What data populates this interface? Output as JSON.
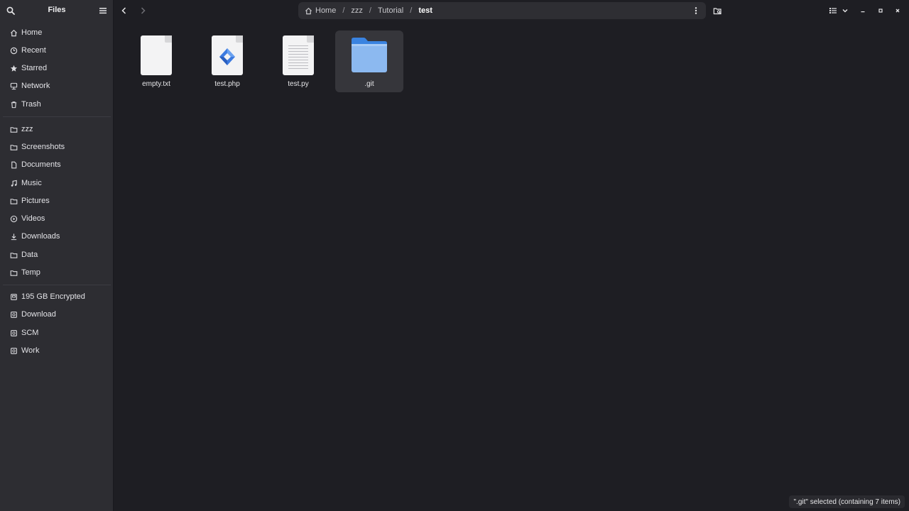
{
  "app": {
    "title": "Files"
  },
  "sidebar": {
    "places": [
      {
        "label": "Home",
        "icon": "home-icon"
      },
      {
        "label": "Recent",
        "icon": "clock-icon"
      },
      {
        "label": "Starred",
        "icon": "star-icon"
      },
      {
        "label": "Network",
        "icon": "network-icon"
      },
      {
        "label": "Trash",
        "icon": "trash-icon"
      }
    ],
    "bookmarks": [
      {
        "label": "zzz",
        "icon": "folder-icon"
      },
      {
        "label": "Screenshots",
        "icon": "folder-icon"
      },
      {
        "label": "Documents",
        "icon": "document-icon"
      },
      {
        "label": "Music",
        "icon": "music-icon"
      },
      {
        "label": "Pictures",
        "icon": "folder-icon"
      },
      {
        "label": "Videos",
        "icon": "video-icon"
      },
      {
        "label": "Downloads",
        "icon": "download-icon"
      },
      {
        "label": "Data",
        "icon": "folder-icon"
      },
      {
        "label": "Temp",
        "icon": "folder-icon"
      }
    ],
    "devices": [
      {
        "label": "195 GB Encrypted",
        "icon": "drive-icon"
      },
      {
        "label": "Download",
        "icon": "drive-icon"
      },
      {
        "label": "SCM",
        "icon": "drive-icon"
      },
      {
        "label": "Work",
        "icon": "drive-icon"
      }
    ]
  },
  "pathbar": {
    "crumbs": [
      "Home",
      "zzz",
      "Tutorial",
      "test"
    ],
    "separator": "/"
  },
  "files": [
    {
      "name": "empty.txt",
      "type": "text"
    },
    {
      "name": "test.php",
      "type": "php"
    },
    {
      "name": "test.py",
      "type": "python"
    },
    {
      "name": ".git",
      "type": "folder",
      "selected": true
    }
  ],
  "status": {
    "text": "\".git\" selected  (containing 7 items)"
  },
  "colors": {
    "sidebar_bg": "#2d2d32",
    "content_bg": "#1e1e23",
    "folder_blue": "#4a90e2",
    "selection_bg": "#36363b"
  }
}
